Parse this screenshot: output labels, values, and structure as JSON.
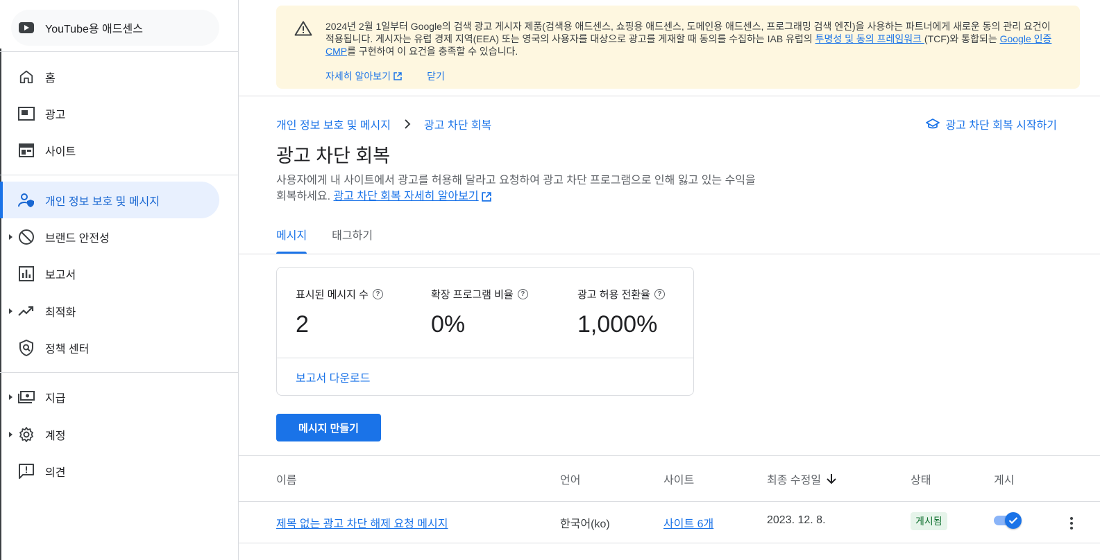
{
  "sidebar": {
    "product": "YouTube용 애드센스",
    "items": [
      {
        "label": "홈",
        "icon": "home-icon"
      },
      {
        "label": "광고",
        "icon": "ads-icon"
      },
      {
        "label": "사이트",
        "icon": "sites-icon"
      },
      {
        "label": "개인 정보 보호 및 메시지",
        "icon": "privacy-messaging-icon",
        "active": true
      },
      {
        "label": "브랜드 안전성",
        "icon": "block-icon"
      },
      {
        "label": "보고서",
        "icon": "reports-icon"
      },
      {
        "label": "최적화",
        "icon": "trending-icon"
      },
      {
        "label": "정책 센터",
        "icon": "policy-icon"
      },
      {
        "label": "지급",
        "icon": "payments-icon"
      },
      {
        "label": "계정",
        "icon": "gear-icon"
      },
      {
        "label": "의견",
        "icon": "feedback-icon"
      }
    ]
  },
  "banner": {
    "text_1": "2024년 2월 1일부터 Google의 검색 광고 게시자 제품(검색용 애드센스, 쇼핑용 애드센스, 도메인용 애드센스, 프로그래밍 검색 엔진)을 사용하는 파트너에게 새로운 동의 관리 요건이 적용됩니다. 게시자는 유럽 경제 지역(EEA) 또는 영국의 사용자를 대상으로 광고를 게재할 때 동의를 수집하는 IAB 유럽의 ",
    "link_tcf": "투명성 및 동의 프레임워크 ",
    "text_2": "(TCF)와 통합되는 ",
    "link_cmp": "Google 인증 CMP",
    "text_3": "를 구현하여 이 요건을 충족할 수 있습니다.",
    "learn_more": "자세히 알아보기",
    "close": "닫기"
  },
  "breadcrumb": {
    "parent": "개인 정보 보호 및 메시지",
    "current": "광고 차단 회복"
  },
  "start_link": "광고 차단 회복 시작하기",
  "page_title": "광고 차단 회복",
  "description": {
    "text": "사용자에게 내 사이트에서 광고를 허용해 달라고 요청하여 광고 차단 프로그램으로 인해 잃고 있는 수익을 회복하세요. ",
    "link": "광고 차단 회복 자세히 알아보기"
  },
  "tabs": [
    {
      "label": "메시지",
      "active": true
    },
    {
      "label": "태그하기",
      "active": false
    }
  ],
  "metrics": [
    {
      "label": "표시된 메시지 수",
      "value": "2"
    },
    {
      "label": "확장 프로그램 비율",
      "value": "0%"
    },
    {
      "label": "광고 허용 전환율",
      "value": "1,000%"
    }
  ],
  "download_report": "보고서 다운로드",
  "create_button": "메시지 만들기",
  "table": {
    "headers": {
      "name": "이름",
      "language": "언어",
      "site": "사이트",
      "modified": "최종 수정일",
      "status": "상태",
      "publish": "게시"
    },
    "rows": [
      {
        "name": "제목 없는 광고 차단 해제 요청 메시지",
        "language": "한국어(ko)",
        "site": "사이트 6개",
        "modified": "2023. 12. 8.",
        "status": "게시됨",
        "published": true
      }
    ]
  },
  "colors": {
    "accent": "#1a73e8",
    "banner_bg": "#fef7e0",
    "active_nav_bg": "#e8f0fe",
    "status_bg": "#e6f4ea",
    "status_text": "#137333"
  }
}
